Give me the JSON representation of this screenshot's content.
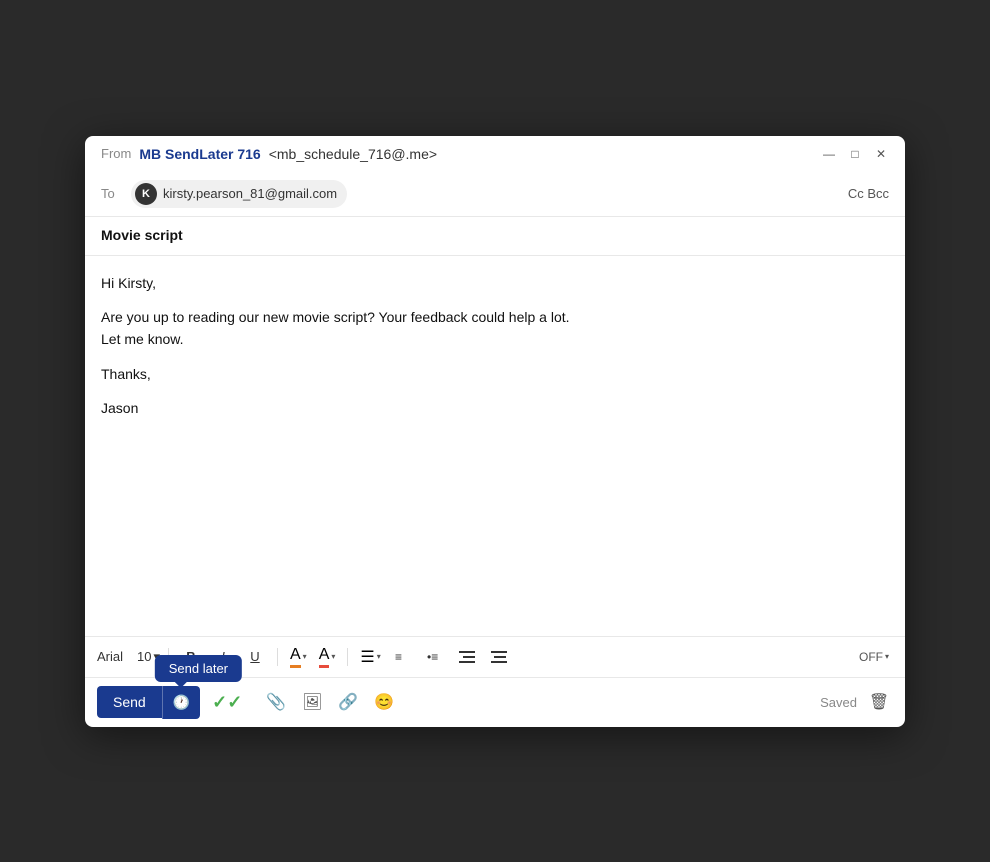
{
  "window": {
    "controls": {
      "minimize": "—",
      "maximize": "□",
      "close": "✕"
    }
  },
  "header": {
    "from_label": "From",
    "sender_name": "MB SendLater 716",
    "sender_email": "<mb_schedule_716@.me>",
    "to_label": "To",
    "recipient_avatar": "K",
    "recipient_email": "kirsty.pearson_81@gmail.com",
    "cc_bcc": "Cc  Bcc"
  },
  "subject": "Movie script",
  "body": {
    "greeting": "Hi Kirsty,",
    "paragraph1": "Are you up to reading our new movie script? Your feedback could help a lot.",
    "paragraph2": "Let me know.",
    "closing": "Thanks,",
    "signature": "Jason"
  },
  "toolbar": {
    "font_name": "Arial",
    "font_size": "10",
    "bold": "B",
    "italic": "I",
    "underline": "U",
    "off_label": "OFF",
    "send_label": "Send",
    "send_later_tooltip": "Send later",
    "saved_label": "Saved"
  }
}
